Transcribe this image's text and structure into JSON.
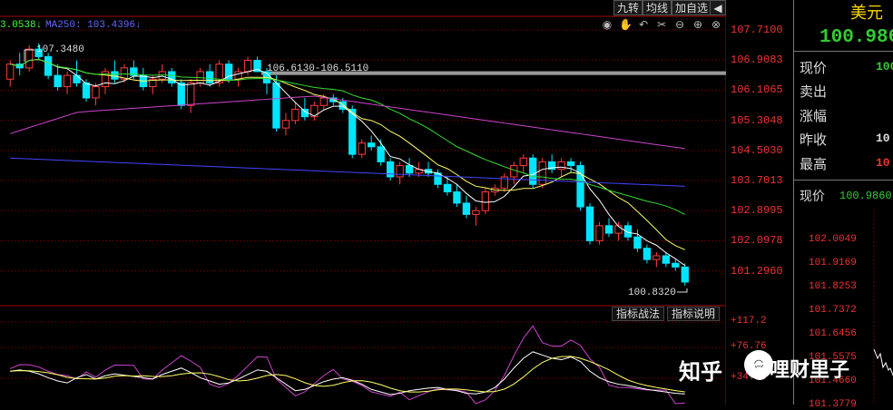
{
  "toolbar": {
    "buttons": [
      "九转",
      "均线",
      "加自选"
    ],
    "nav_icon": "chevron-left-icon"
  },
  "ma_legend": {
    "ma_a": "3.0538↓",
    "ma250": "MA250: 103.4396↓"
  },
  "price_axis": [
    "107.7100",
    "106.9083",
    "106.1065",
    "105.3048",
    "104.5030",
    "103.7013",
    "102.8995",
    "102.0978",
    "101.2960"
  ],
  "annotations": {
    "high_label": "107.3480",
    "range_label": "106.6130-106.5110",
    "low_label": "100.8320"
  },
  "indicator_axis": [
    "+117.2",
    "+76.76",
    "+34.28"
  ],
  "indicator_buttons": [
    "指标战法",
    "指标说明"
  ],
  "side_panel": {
    "title": "美元",
    "price": "100.986",
    "rows": [
      {
        "label": "现价",
        "value": "100"
      },
      {
        "label": "卖出",
        "value": ""
      },
      {
        "label": "涨幅",
        "value": ""
      },
      {
        "label": "昨收",
        "value": "10"
      },
      {
        "label": "最高",
        "value": "10"
      }
    ],
    "mini_label": "现价",
    "mini_value": "100.9860",
    "mini_axis": [
      "102.0049",
      "101.9169",
      "101.8253",
      "101.7372",
      "101.6456",
      "101.5575",
      "101.4660",
      "101.3779"
    ]
  },
  "watermark": {
    "site": "知乎",
    "author": "@哩财里子"
  },
  "chart_data": {
    "type": "candlestick",
    "ylim": [
      100.83,
      107.71
    ],
    "candles": [
      [
        106.4,
        106.9,
        106.2,
        106.8
      ],
      [
        106.8,
        107.1,
        106.5,
        106.7
      ],
      [
        106.7,
        107.3,
        106.6,
        107.2
      ],
      [
        107.2,
        107.35,
        106.9,
        107.0
      ],
      [
        107.0,
        107.1,
        106.4,
        106.5
      ],
      [
        106.5,
        106.8,
        106.1,
        106.2
      ],
      [
        106.2,
        106.6,
        106.0,
        106.5
      ],
      [
        106.5,
        106.9,
        106.2,
        106.3
      ],
      [
        106.3,
        106.4,
        105.8,
        105.9
      ],
      [
        105.9,
        106.3,
        105.7,
        106.2
      ],
      [
        106.2,
        106.7,
        106.0,
        106.6
      ],
      [
        106.6,
        106.9,
        106.3,
        106.4
      ],
      [
        106.4,
        106.8,
        106.3,
        106.7
      ],
      [
        106.7,
        106.9,
        106.4,
        106.5
      ],
      [
        106.5,
        106.7,
        106.1,
        106.2
      ],
      [
        106.2,
        106.5,
        106.0,
        106.4
      ],
      [
        106.4,
        106.8,
        106.3,
        106.6
      ],
      [
        106.6,
        106.7,
        106.2,
        106.3
      ],
      [
        106.3,
        106.4,
        105.6,
        105.7
      ],
      [
        105.7,
        106.4,
        105.5,
        106.3
      ],
      [
        106.3,
        106.7,
        106.2,
        106.6
      ],
      [
        106.6,
        106.8,
        106.2,
        106.3
      ],
      [
        106.3,
        106.9,
        106.2,
        106.8
      ],
      [
        106.8,
        106.9,
        106.3,
        106.4
      ],
      [
        106.4,
        106.7,
        106.2,
        106.6
      ],
      [
        106.6,
        107.0,
        106.5,
        106.9
      ],
      [
        106.9,
        107.0,
        106.6,
        106.6
      ],
      [
        106.6,
        106.7,
        106.0,
        106.3
      ],
      [
        106.3,
        106.5,
        105.0,
        105.1
      ],
      [
        105.1,
        105.5,
        104.9,
        105.3
      ],
      [
        105.3,
        105.8,
        105.2,
        105.6
      ],
      [
        105.6,
        105.9,
        105.3,
        105.4
      ],
      [
        105.4,
        105.8,
        105.3,
        105.7
      ],
      [
        105.7,
        106.0,
        105.6,
        105.9
      ],
      [
        105.9,
        106.0,
        105.7,
        105.8
      ],
      [
        105.8,
        105.9,
        105.5,
        105.6
      ],
      [
        105.6,
        105.7,
        104.3,
        104.4
      ],
      [
        104.4,
        104.8,
        104.3,
        104.7
      ],
      [
        104.7,
        104.9,
        104.5,
        104.6
      ],
      [
        104.6,
        104.8,
        104.1,
        104.2
      ],
      [
        104.2,
        104.3,
        103.7,
        103.8
      ],
      [
        103.8,
        104.2,
        103.6,
        104.1
      ],
      [
        104.1,
        104.3,
        103.8,
        103.9
      ],
      [
        103.9,
        104.2,
        103.8,
        104.0
      ],
      [
        104.0,
        104.2,
        103.8,
        103.9
      ],
      [
        103.9,
        104.0,
        103.5,
        103.6
      ],
      [
        103.6,
        103.8,
        103.3,
        103.4
      ],
      [
        103.4,
        103.6,
        103.0,
        103.1
      ],
      [
        103.1,
        103.3,
        102.7,
        102.8
      ],
      [
        102.8,
        103.0,
        102.5,
        102.9
      ],
      [
        102.9,
        103.5,
        102.8,
        103.4
      ],
      [
        103.4,
        103.6,
        103.3,
        103.5
      ],
      [
        103.5,
        103.9,
        103.4,
        103.8
      ],
      [
        103.8,
        104.2,
        103.6,
        104.1
      ],
      [
        104.1,
        104.4,
        103.9,
        104.3
      ],
      [
        104.3,
        104.4,
        103.5,
        103.6
      ],
      [
        103.6,
        104.3,
        103.5,
        104.2
      ],
      [
        104.2,
        104.4,
        103.9,
        104.0
      ],
      [
        104.0,
        104.3,
        103.8,
        104.2
      ],
      [
        104.2,
        104.3,
        103.9,
        104.1
      ],
      [
        104.1,
        104.2,
        102.9,
        103.0
      ],
      [
        103.0,
        103.1,
        102.0,
        102.1
      ],
      [
        102.1,
        102.6,
        102.0,
        102.5
      ],
      [
        102.5,
        102.7,
        102.2,
        102.3
      ],
      [
        102.3,
        102.6,
        102.1,
        102.5
      ],
      [
        102.5,
        102.6,
        102.1,
        102.2
      ],
      [
        102.2,
        102.4,
        101.8,
        101.9
      ],
      [
        101.9,
        102.0,
        101.5,
        101.6
      ],
      [
        101.6,
        101.8,
        101.4,
        101.7
      ],
      [
        101.7,
        101.8,
        101.4,
        101.5
      ],
      [
        101.5,
        101.6,
        101.3,
        101.4
      ],
      [
        101.4,
        101.5,
        100.9,
        101.0
      ]
    ]
  }
}
